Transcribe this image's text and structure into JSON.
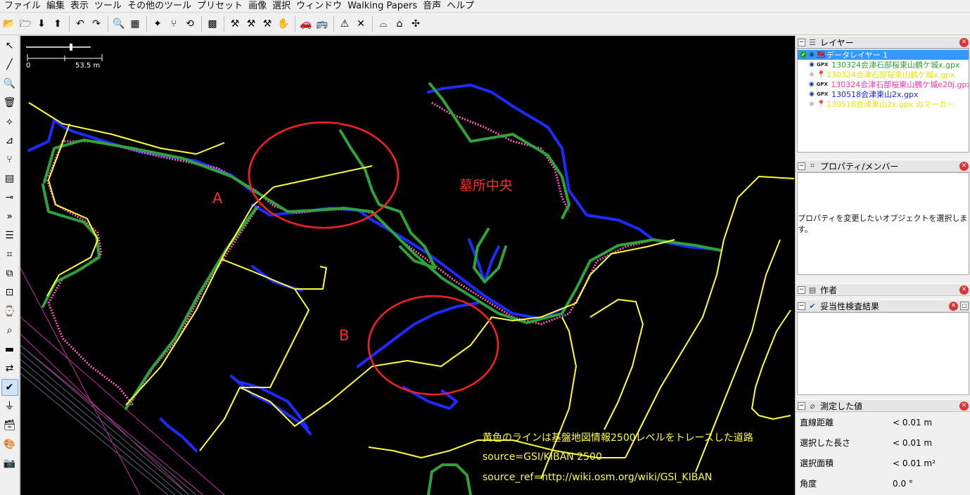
{
  "menu": [
    "ファイル",
    "編集",
    "表示",
    "ツール",
    "その他のツール",
    "プリセット",
    "画像",
    "選択",
    "ウィンドウ",
    "Walking Papers",
    "音声",
    "ヘルプ"
  ],
  "toolbar_icons": [
    {
      "name": "open-file-icon",
      "glyph": "📂"
    },
    {
      "name": "open-location-icon",
      "glyph": "🗁"
    },
    {
      "name": "download-icon",
      "glyph": "⬇"
    },
    {
      "name": "upload-icon",
      "glyph": "⬆"
    },
    {
      "name": "undo-icon",
      "glyph": "↶"
    },
    {
      "name": "redo-icon",
      "glyph": "↷"
    },
    {
      "name": "preferences-icon",
      "glyph": "🔍"
    },
    {
      "name": "info-icon",
      "glyph": "▦"
    },
    {
      "name": "align-icon",
      "glyph": "✦"
    },
    {
      "name": "split-way-icon",
      "glyph": "⑂"
    },
    {
      "name": "reverse-way-icon",
      "glyph": "⟲"
    },
    {
      "name": "wireframe-icon",
      "glyph": "▩"
    },
    {
      "name": "highway-icon",
      "glyph": "⚒"
    },
    {
      "name": "path-icon",
      "glyph": "⚒"
    },
    {
      "name": "track-icon",
      "glyph": "⚒"
    },
    {
      "name": "hand-icon",
      "glyph": "✋"
    },
    {
      "name": "car-icon",
      "glyph": "🚗"
    },
    {
      "name": "bus-icon",
      "glyph": "🚌"
    },
    {
      "name": "hazard-icon",
      "glyph": "⚠"
    },
    {
      "name": "cross-icon",
      "glyph": "✕"
    },
    {
      "name": "bridge-icon",
      "glyph": "⌓"
    },
    {
      "name": "factory-icon",
      "glyph": "⌂"
    },
    {
      "name": "puzzle-icon",
      "glyph": "✣"
    }
  ],
  "left_tools": [
    {
      "name": "select-tool-icon",
      "glyph": "↖",
      "selected": false
    },
    {
      "name": "draw-line-icon",
      "glyph": "╱",
      "selected": false
    },
    {
      "name": "zoom-icon",
      "glyph": "🔍",
      "selected": false
    },
    {
      "name": "delete-icon",
      "glyph": "🗑",
      "selected": false
    },
    {
      "name": "lasso-icon",
      "glyph": "⟡",
      "selected": false
    },
    {
      "name": "improve-way-icon",
      "glyph": "⊿",
      "selected": false
    },
    {
      "name": "extrude-icon",
      "glyph": "⑂",
      "selected": false
    },
    {
      "name": "building-icon",
      "glyph": "▤",
      "selected": false
    },
    {
      "name": "parallel-icon",
      "glyph": "⊸",
      "selected": false
    },
    {
      "name": "more-tools-icon",
      "glyph": "»",
      "selected": false
    },
    {
      "name": "layers-toggle-icon",
      "glyph": "☰",
      "selected": false
    },
    {
      "name": "tags-toggle-icon",
      "glyph": "⌗",
      "selected": false
    },
    {
      "name": "relations-icon",
      "glyph": "⧉",
      "selected": false
    },
    {
      "name": "selection-list-icon",
      "glyph": "⊡",
      "selected": false
    },
    {
      "name": "history-icon",
      "glyph": "⌚",
      "selected": false
    },
    {
      "name": "search-panel-icon",
      "glyph": "⌕",
      "selected": false
    },
    {
      "name": "notes-icon",
      "glyph": "▬",
      "selected": false
    },
    {
      "name": "conflict-icon",
      "glyph": "⇄",
      "selected": false
    },
    {
      "name": "validator-icon",
      "glyph": "✔",
      "selected": true
    },
    {
      "name": "filter-icon",
      "glyph": "⏚",
      "selected": false
    },
    {
      "name": "basket-icon",
      "glyph": "🗃",
      "selected": false
    },
    {
      "name": "palette-icon",
      "glyph": "🎨",
      "selected": false
    },
    {
      "name": "camera-icon",
      "glyph": "📷",
      "selected": false
    }
  ],
  "map": {
    "scale_zero": "0",
    "scale_dist": "53.5 m",
    "label_a": "A",
    "label_b": "B",
    "label_grave": "墓所中央",
    "note_line1": "黄色のラインは基盤地図情報2500レベルをトレースした道路",
    "note_line2": "source=GSI/KIBAN 2500",
    "note_line3": "source_ref=http://wiki.osm.org/wiki/GSI_KIBAN",
    "colors": {
      "background": "#000000",
      "yellow": "#ffff33",
      "green": "#2ea33a",
      "pink": "#ff55bb",
      "blue": "#1e2bff",
      "red": "#ff1f1f",
      "rail": "#d02aa6"
    }
  },
  "panels": {
    "layers": {
      "title": "レイヤー",
      "items": [
        {
          "label": "データレイヤー 1",
          "type": "data",
          "visible": true,
          "active": true,
          "color": "#ffffff"
        },
        {
          "label": "130324会津石部桜東山鶴ケ城x.gpx",
          "type": "GPX",
          "visible": true,
          "active": false,
          "color": "#2ea33a"
        },
        {
          "label": "130324会津石部桜東山鶴ケ城x.gpx",
          "type": "marker",
          "visible": false,
          "active": false,
          "color": "#e6e600"
        },
        {
          "label": "130324会津石部桜東山鶴ケ城e20j.gpx",
          "type": "GPX",
          "visible": true,
          "active": false,
          "color": "#ff33aa"
        },
        {
          "label": "130518会津東山2x.gpx",
          "type": "GPX",
          "visible": true,
          "active": false,
          "color": "#1a22ff"
        },
        {
          "label": "130518会津東山2x.gpx のマーカー",
          "type": "marker",
          "visible": false,
          "active": false,
          "color": "#e6e600"
        }
      ]
    },
    "properties": {
      "title": "プロパティ/メンバー",
      "message": "プロパティを変更したいオブジェクトを選択します。"
    },
    "author": {
      "title": "作者"
    },
    "validation": {
      "title": "妥当性検査結果"
    },
    "measure": {
      "title": "測定した値",
      "rows": [
        {
          "label": "直線距離",
          "value": "< 0.01 m"
        },
        {
          "label": "選択した長さ",
          "value": "< 0.01 m"
        },
        {
          "label": "選択面積",
          "value": "< 0.01 m²"
        },
        {
          "label": "角度",
          "value": "0.0 °"
        }
      ]
    }
  }
}
